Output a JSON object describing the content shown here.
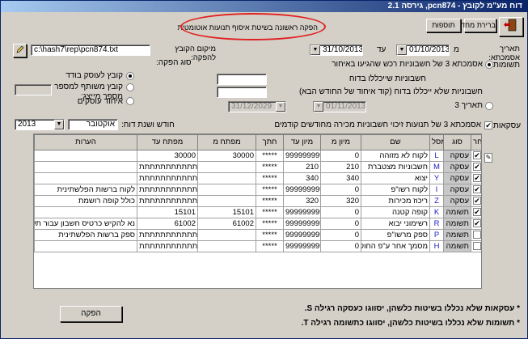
{
  "window": {
    "title": "דוח מע\"מ לקובץ - pcn874, גירסה 2.1"
  },
  "toolbar": {
    "exit_label": "יציאה",
    "default_label": "ברירת מחדל",
    "add_label": "תוספות",
    "heading": "הפקה ראשונה בשיטת איסוף תנועות אוטומטית"
  },
  "filters": {
    "date_label": "תאריך אסמכתא:",
    "from_label": "מ",
    "from_value": "01/10/2013",
    "to_label": "עד",
    "to_value": "31/10/2013",
    "path_label": "מיקום הקובץ להפקה:",
    "path_value": "c:\\hash7\\rep\\pcn874.txt",
    "payments_label": "תשומות",
    "payments_option": "אסמכתא 3 של חשבוניות רכש שהגיעו באיחור",
    "unclosed_invoices": "חשבוניות שייכללו בדוח",
    "unclosed_next": "חשבוניות שלא ייכללו בדוח (קוד איחוד של החודש הבא)",
    "date3_label": "תאריך 3",
    "date3_from": "01/11/2013",
    "date3_to": "31/12/2029",
    "production_type_label": "סוג הפקה:",
    "prod_options": [
      "קובץ לעוסק בודד",
      "קובץ משותף למספר עוסקים",
      "איחוד עוסקים"
    ],
    "dealer_number_label": "מספר מייצג:",
    "sales_label": "עסקאות",
    "sales_option": "אסמכתא 3 של תנועות זיכוי חשבוניות מכירה מחודשים קודמים",
    "report_month_label": "חודש ושנת דוח:",
    "report_month": "אוקטובר",
    "report_year": "2013"
  },
  "grid": {
    "headers": [
      "בחר",
      "סוג",
      "מסל",
      "שם",
      "מיון מ",
      "מיון עד",
      "חתך",
      "מפתח מ",
      "מפתח עד",
      "הערות"
    ],
    "rows": [
      {
        "checked": true,
        "type": "עסקה",
        "code": "L",
        "name": "לקוח לא מזוהה",
        "sort_from": "0",
        "sort_to": "999999999",
        "cut": "*****",
        "key_from": "30000",
        "key_to": "30000",
        "notes": ""
      },
      {
        "checked": true,
        "type": "עסקה",
        "code": "M",
        "name": "חשבוניות מצטברת",
        "sort_from": "210",
        "sort_to": "210",
        "cut": "*****",
        "key_from": "",
        "key_to": "תתתתתתתתתתתתתת",
        "notes": ""
      },
      {
        "checked": true,
        "type": "עסקה",
        "code": "Y",
        "name": "יצוא",
        "sort_from": "340",
        "sort_to": "340",
        "cut": "*****",
        "key_from": "",
        "key_to": "תתתתתתתתתתתתתת",
        "notes": ""
      },
      {
        "checked": true,
        "type": "עסקה",
        "code": "I",
        "name": "לקוח רשו\"פ",
        "sort_from": "0",
        "sort_to": "999999999",
        "cut": "*****",
        "key_from": "",
        "key_to": "תתתתתתתתתתתתתת",
        "notes": "לקוח ברשות הפלשתינית"
      },
      {
        "checked": true,
        "type": "עסקה",
        "code": "Z",
        "name": "ריכוז מכירות",
        "sort_from": "320",
        "sort_to": "320",
        "cut": "*****",
        "key_from": "",
        "key_to": "תתתתתתתתתתתתתת",
        "notes": "כולל קופה רושמת"
      },
      {
        "checked": true,
        "type": "תשומה",
        "code": "K",
        "name": "קופה קטנה",
        "sort_from": "0",
        "sort_to": "999999999",
        "cut": "*****",
        "key_from": "15101",
        "key_to": "15101",
        "notes": ""
      },
      {
        "checked": true,
        "type": "תשומה",
        "code": "R",
        "name": "רשימוני יבוא",
        "sort_from": "0",
        "sort_to": "999999999",
        "cut": "*****",
        "key_from": "61002",
        "key_to": "61002",
        "notes": "נא להקיש כרטיס חשבון עבור תשומות"
      },
      {
        "checked": false,
        "type": "תשומה",
        "code": "P",
        "name": "ספק מרשו\"פ",
        "sort_from": "0",
        "sort_to": "999999999",
        "cut": "*****",
        "key_from": "",
        "key_to": "תתתתתתתתתתתתתת",
        "notes": "ספק ברשות הפלשתינית"
      },
      {
        "checked": false,
        "type": "תשומה",
        "code": "H",
        "name": "מסמך אחר ע\"פ החוק",
        "sort_from": "0",
        "sort_to": "999999999",
        "cut": "*****",
        "key_from": "",
        "key_to": "תתתתתתתתתתתתתת",
        "notes": ""
      }
    ]
  },
  "footer": {
    "produce_label": "הפקה",
    "note1": "* עסקאות שלא נכללו בשיטות כלשהן, יסווגו כעסקה רגילה S.",
    "note2": "* תשומות שלא נכללו בשיטות כלשהן, יסווגו כתשומה רגילה T."
  }
}
